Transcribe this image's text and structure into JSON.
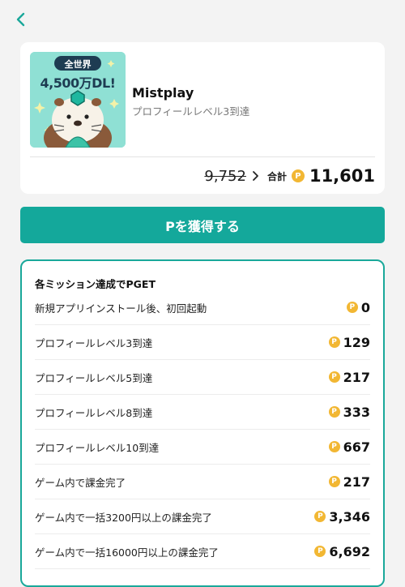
{
  "header": {
    "back_icon": "chevron-left-icon"
  },
  "app": {
    "name": "Mistplay",
    "subtitle": "プロフィールレベル3到達",
    "thumbnail": {
      "badge_line1": "全世界",
      "badge_line2": "4,500万DL!"
    }
  },
  "points": {
    "old_value": "9,752",
    "arrow_icon": "chevron-right-icon",
    "total_label": "合計",
    "coin_symbol": "P",
    "total_value": "11,601"
  },
  "cta": {
    "label": "Pを獲得する"
  },
  "missions": {
    "heading": "各ミッション達成でPGET",
    "items": [
      {
        "label": "新規アプリインストール後、初回起動",
        "points": "0"
      },
      {
        "label": "プロフィールレベル3到達",
        "points": "129"
      },
      {
        "label": "プロフィールレベル5到達",
        "points": "217"
      },
      {
        "label": "プロフィールレベル8到達",
        "points": "333"
      },
      {
        "label": "プロフィールレベル10到達",
        "points": "667"
      },
      {
        "label": "ゲーム内で課金完了",
        "points": "217"
      },
      {
        "label": "ゲーム内で一括3200円以上の課金完了",
        "points": "3,346"
      },
      {
        "label": "ゲーム内で一括16000円以上の課金完了",
        "points": "6,692"
      }
    ]
  },
  "colors": {
    "accent": "#14a89b",
    "coin": "#f2b733",
    "background": "#f3f3f3"
  }
}
